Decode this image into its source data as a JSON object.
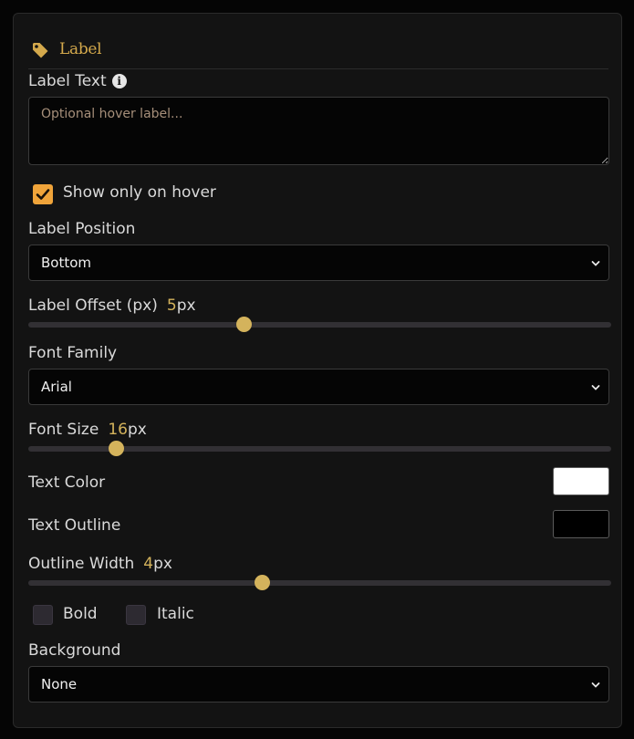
{
  "section": {
    "title": "Label",
    "icon": "tag-icon"
  },
  "label_text": {
    "label": "Label Text",
    "info_icon": "info-icon",
    "placeholder": "Optional hover label..."
  },
  "show_on_hover": {
    "label": "Show only on hover",
    "checked": true
  },
  "label_position": {
    "label": "Label Position",
    "value": "Bottom"
  },
  "label_offset": {
    "label": "Label Offset (px)",
    "value": "5",
    "unit": "px",
    "slider_fraction": 0.37
  },
  "font_family": {
    "label": "Font Family",
    "value": "Arial"
  },
  "font_size": {
    "label": "Font Size",
    "value": "16",
    "unit": "px",
    "slider_fraction": 0.15
  },
  "text_color": {
    "label": "Text Color",
    "color": "#ffffff"
  },
  "text_outline": {
    "label": "Text Outline",
    "color": "#000000"
  },
  "outline_width": {
    "label": "Outline Width",
    "value": "4",
    "unit": "px",
    "slider_fraction": 0.4
  },
  "bold": {
    "label": "Bold",
    "checked": false
  },
  "italic": {
    "label": "Italic",
    "checked": false
  },
  "background": {
    "label": "Background",
    "value": "None"
  },
  "colors": {
    "accent": "#d4b35c",
    "checkbox_on": "#f0a43a",
    "header": "#d4a94c"
  }
}
